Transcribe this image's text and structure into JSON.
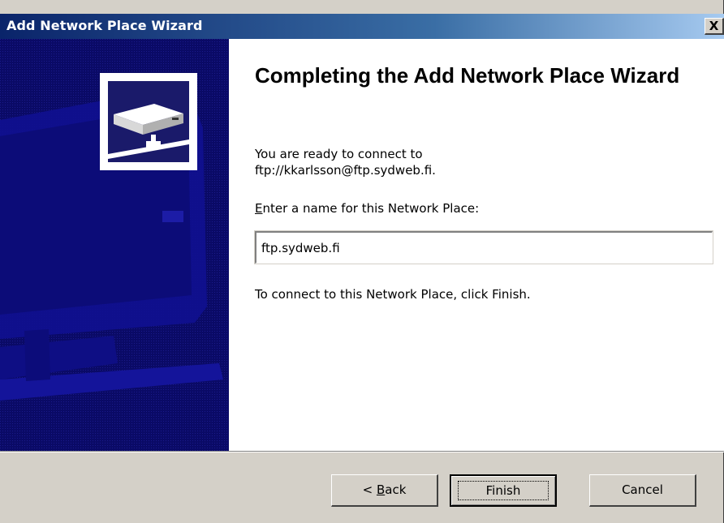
{
  "window": {
    "title": "Add Network Place Wizard",
    "close_label": "X"
  },
  "colors": {
    "titlebar_start": "#0a246a",
    "titlebar_end": "#a6caf0",
    "sidebar": "#0a0a6a",
    "dialog_face": "#d4d0c8"
  },
  "sidebar": {
    "icon": "network-drive-icon"
  },
  "content": {
    "heading": "Completing the Add Network Place Wizard",
    "ready_line1": "You are ready to connect to",
    "ready_line2": "ftp://kkarlsson@ftp.sydweb.fi.",
    "name_label_mnemonic": "E",
    "name_label_rest": "nter a name for this Network Place:",
    "name_value": "ftp.sydweb.fi",
    "finish_instruction": "To connect to this Network Place, click Finish."
  },
  "buttons": {
    "back_prefix": "< ",
    "back_mnemonic": "B",
    "back_rest": "ack",
    "finish": "Finish",
    "cancel": "Cancel"
  }
}
